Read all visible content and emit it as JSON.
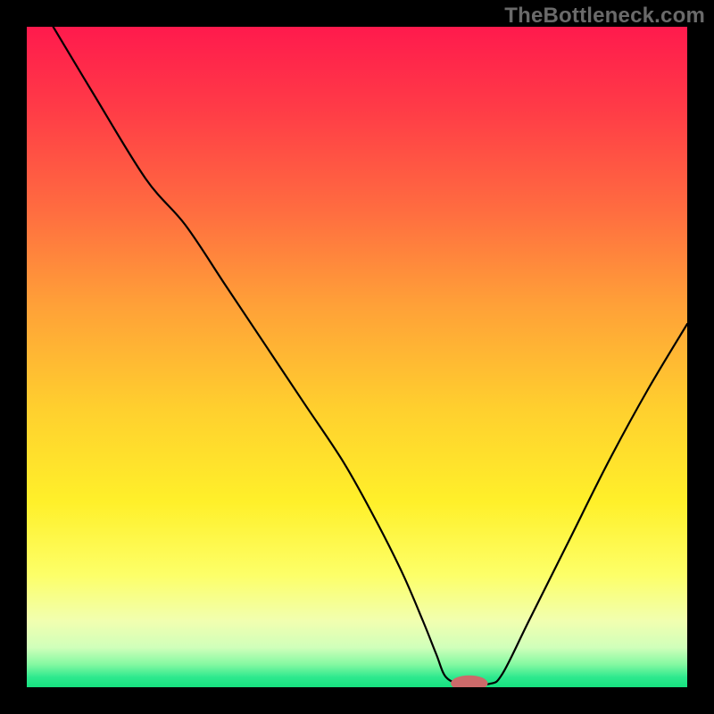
{
  "watermark": "TheBottleneck.com",
  "colors": {
    "gradient_stops": [
      {
        "offset": 0.0,
        "color": "#ff1a4d"
      },
      {
        "offset": 0.12,
        "color": "#ff3a47"
      },
      {
        "offset": 0.28,
        "color": "#ff6d40"
      },
      {
        "offset": 0.42,
        "color": "#ffa038"
      },
      {
        "offset": 0.58,
        "color": "#ffd02e"
      },
      {
        "offset": 0.72,
        "color": "#fff02a"
      },
      {
        "offset": 0.83,
        "color": "#fdff68"
      },
      {
        "offset": 0.9,
        "color": "#f1ffb0"
      },
      {
        "offset": 0.94,
        "color": "#d0ffba"
      },
      {
        "offset": 0.965,
        "color": "#86f9a2"
      },
      {
        "offset": 0.985,
        "color": "#2de98e"
      },
      {
        "offset": 1.0,
        "color": "#16e17f"
      }
    ],
    "curve": "#000000",
    "marker_fill": "#cc6a6a",
    "background": "#000000"
  },
  "chart_data": {
    "type": "line",
    "title": "",
    "xlabel": "",
    "ylabel": "",
    "xlim": [
      0,
      100
    ],
    "ylim": [
      0,
      100
    ],
    "grid": false,
    "legend": false,
    "series": [
      {
        "name": "bottleneck-curve",
        "x": [
          4,
          10,
          18,
          24,
          30,
          36,
          42,
          48,
          53,
          57,
          60,
          62,
          63.5,
          66,
          70,
          72,
          76,
          82,
          88,
          94,
          100
        ],
        "y": [
          100,
          90,
          77,
          70,
          61,
          52,
          43,
          34,
          25,
          17,
          10,
          5,
          1.5,
          0.5,
          0.5,
          2,
          10,
          22,
          34,
          45,
          55
        ]
      }
    ],
    "marker": {
      "x": 67,
      "y": 0.6,
      "rx": 2.8,
      "ry": 1.2
    },
    "annotations": []
  }
}
